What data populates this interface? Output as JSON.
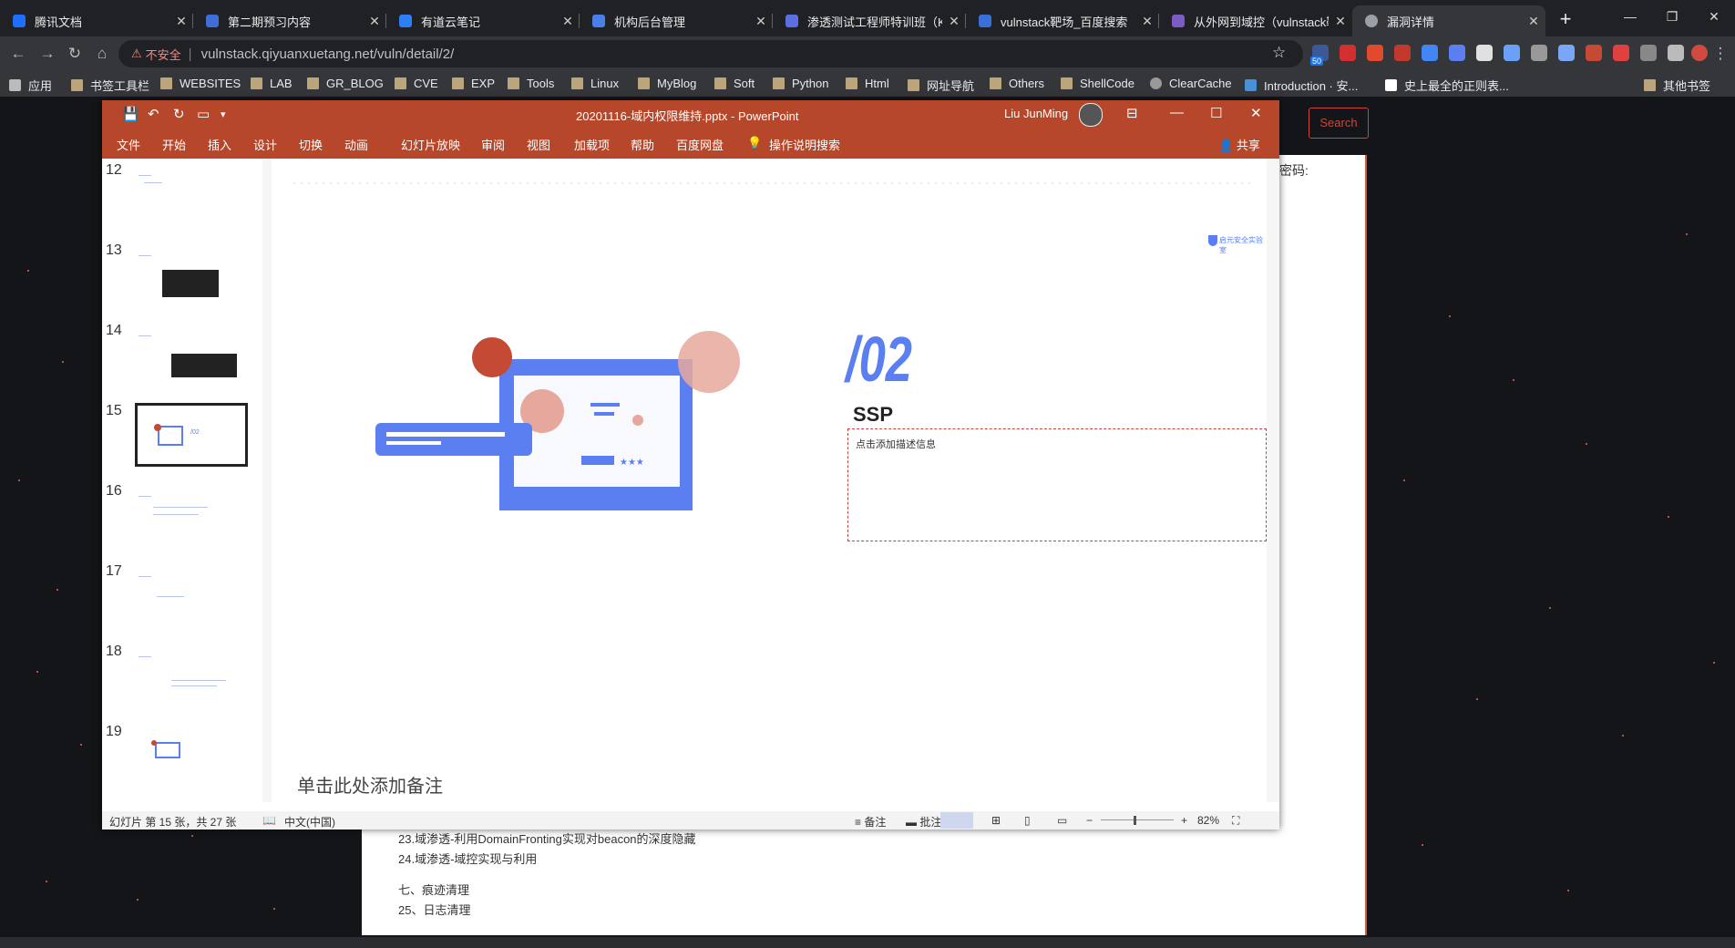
{
  "browser": {
    "tabs": [
      {
        "title": "腾讯文档",
        "color": "#1e6fff"
      },
      {
        "title": "第二期预习内容",
        "color": "#3f6fd6"
      },
      {
        "title": "有道云笔记",
        "color": "#2d7ef7"
      },
      {
        "title": "机构后台管理",
        "color": "#4a7ee8"
      },
      {
        "title": "渗透测试工程师特训班（Ka",
        "color": "#5b6fe0"
      },
      {
        "title": "vulnstack靶场_百度搜索",
        "color": "#3b6fd8"
      },
      {
        "title": "从外网到域控（vulnstack靶",
        "color": "#7a5cc4"
      },
      {
        "title": "漏洞详情",
        "color": "#9aa0a6"
      }
    ],
    "address": {
      "security": "不安全",
      "url": "vulnstack.qiyuanxuetang.net/vuln/detail/2/"
    },
    "extension_badge": "50",
    "bookmarks": [
      {
        "label": "应用",
        "type": "apps"
      },
      {
        "label": "书签工具栏",
        "type": "folder"
      },
      {
        "label": "WEBSITES",
        "type": "folder"
      },
      {
        "label": "LAB",
        "type": "folder"
      },
      {
        "label": "GR_BLOG",
        "type": "folder"
      },
      {
        "label": "CVE",
        "type": "folder"
      },
      {
        "label": "EXP",
        "type": "folder"
      },
      {
        "label": "Tools",
        "type": "folder"
      },
      {
        "label": "Linux",
        "type": "folder"
      },
      {
        "label": "MyBlog",
        "type": "folder"
      },
      {
        "label": "Soft",
        "type": "folder"
      },
      {
        "label": "Python",
        "type": "folder"
      },
      {
        "label": "Html",
        "type": "folder"
      },
      {
        "label": "网址导航",
        "type": "folder"
      },
      {
        "label": "Others",
        "type": "folder"
      },
      {
        "label": "ShellCode",
        "type": "folder"
      },
      {
        "label": "ClearCache",
        "type": "ext"
      },
      {
        "label": "Introduction · 安...",
        "type": "site"
      },
      {
        "label": "史上最全的正则表...",
        "type": "site"
      }
    ],
    "other_bookmarks": "其他书签"
  },
  "page": {
    "search_button": "Search",
    "password_label": "密码:",
    "list_items": [
      "23.域渗透-利用DomainFronting实现对beacon的深度隐藏",
      "24.域渗透-域控实现与利用",
      "七、痕迹清理",
      "25、日志清理"
    ]
  },
  "ppt": {
    "doc_title": "20201116-域内权限维持.pptx  -  PowerPoint",
    "user": "Liu JunMing",
    "ribbon_tabs": [
      "文件",
      "开始",
      "插入",
      "设计",
      "切换",
      "动画",
      "幻灯片放映",
      "审阅",
      "视图",
      "加载项",
      "帮助",
      "百度网盘",
      "操作说明搜索"
    ],
    "share": "共享",
    "thumbnail_numbers": [
      "12",
      "13",
      "14",
      "15",
      "16",
      "17",
      "18",
      "19"
    ],
    "selected_slide": "15",
    "slide": {
      "number_text": "/02",
      "heading": "SSP",
      "placeholder": "点击添加描述信息",
      "logo_text": "启元安全实验室"
    },
    "notes": "单击此处添加备注",
    "status": {
      "slide_count": "幻灯片 第 15 张，共 27 张",
      "language": "中文(中国)",
      "notes_btn": "备注",
      "comments_btn": "批注",
      "zoom": "82%"
    },
    "colors": {
      "accent": "#b7472a",
      "blue": "#5b7ef0",
      "pink": "#e6a89c",
      "red": "#c44a35"
    }
  }
}
